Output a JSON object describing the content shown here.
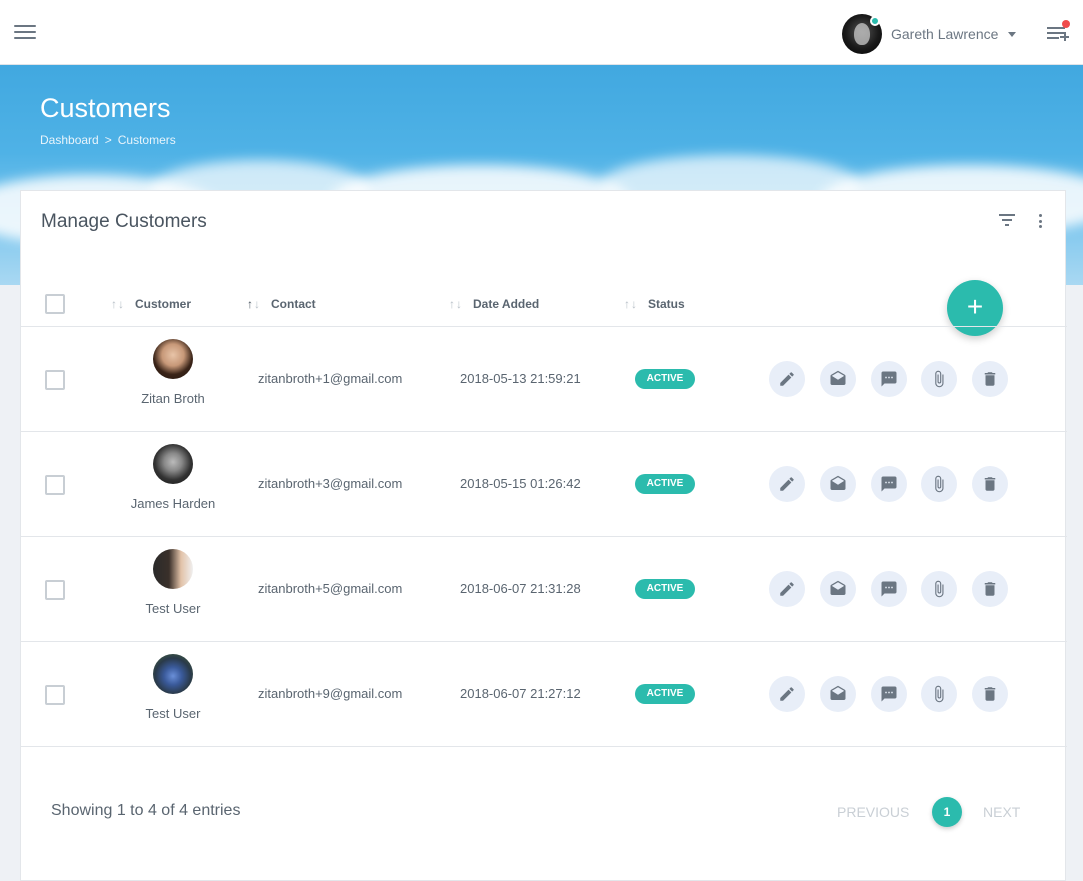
{
  "header": {
    "user_name": "Gareth Lawrence"
  },
  "hero": {
    "title": "Customers",
    "breadcrumb": [
      {
        "label": "Dashboard"
      },
      {
        "label": "Customers"
      }
    ],
    "breadcrumb_separator": ">"
  },
  "card": {
    "title": "Manage Customers",
    "fab_label": "+",
    "columns": {
      "customer": "Customer",
      "contact": "Contact",
      "date_added": "Date Added",
      "status": "Status"
    },
    "rows": [
      {
        "name": "Zitan Broth",
        "email": "zitanbroth+1@gmail.com",
        "date": "2018-05-13 21:59:21",
        "status": "ACTIVE"
      },
      {
        "name": "James Harden",
        "email": "zitanbroth+3@gmail.com",
        "date": "2018-05-15 01:26:42",
        "status": "ACTIVE"
      },
      {
        "name": "Test User",
        "email": "zitanbroth+5@gmail.com",
        "date": "2018-06-07 21:31:28",
        "status": "ACTIVE"
      },
      {
        "name": "Test User",
        "email": "zitanbroth+9@gmail.com",
        "date": "2018-06-07 21:27:12",
        "status": "ACTIVE"
      }
    ],
    "footer": {
      "showing": "Showing 1 to 4 of 4 entries",
      "previous": "PREVIOUS",
      "current_page": "1",
      "next": "NEXT"
    }
  },
  "icons": {
    "row_actions": [
      "pencil-icon",
      "envelope-open-icon",
      "message-icon",
      "paperclip-icon",
      "trash-icon"
    ]
  },
  "colors": {
    "accent": "#2bbbad",
    "notification_badge": "#ef4b4b",
    "action_button_bg": "#e8eef8"
  }
}
